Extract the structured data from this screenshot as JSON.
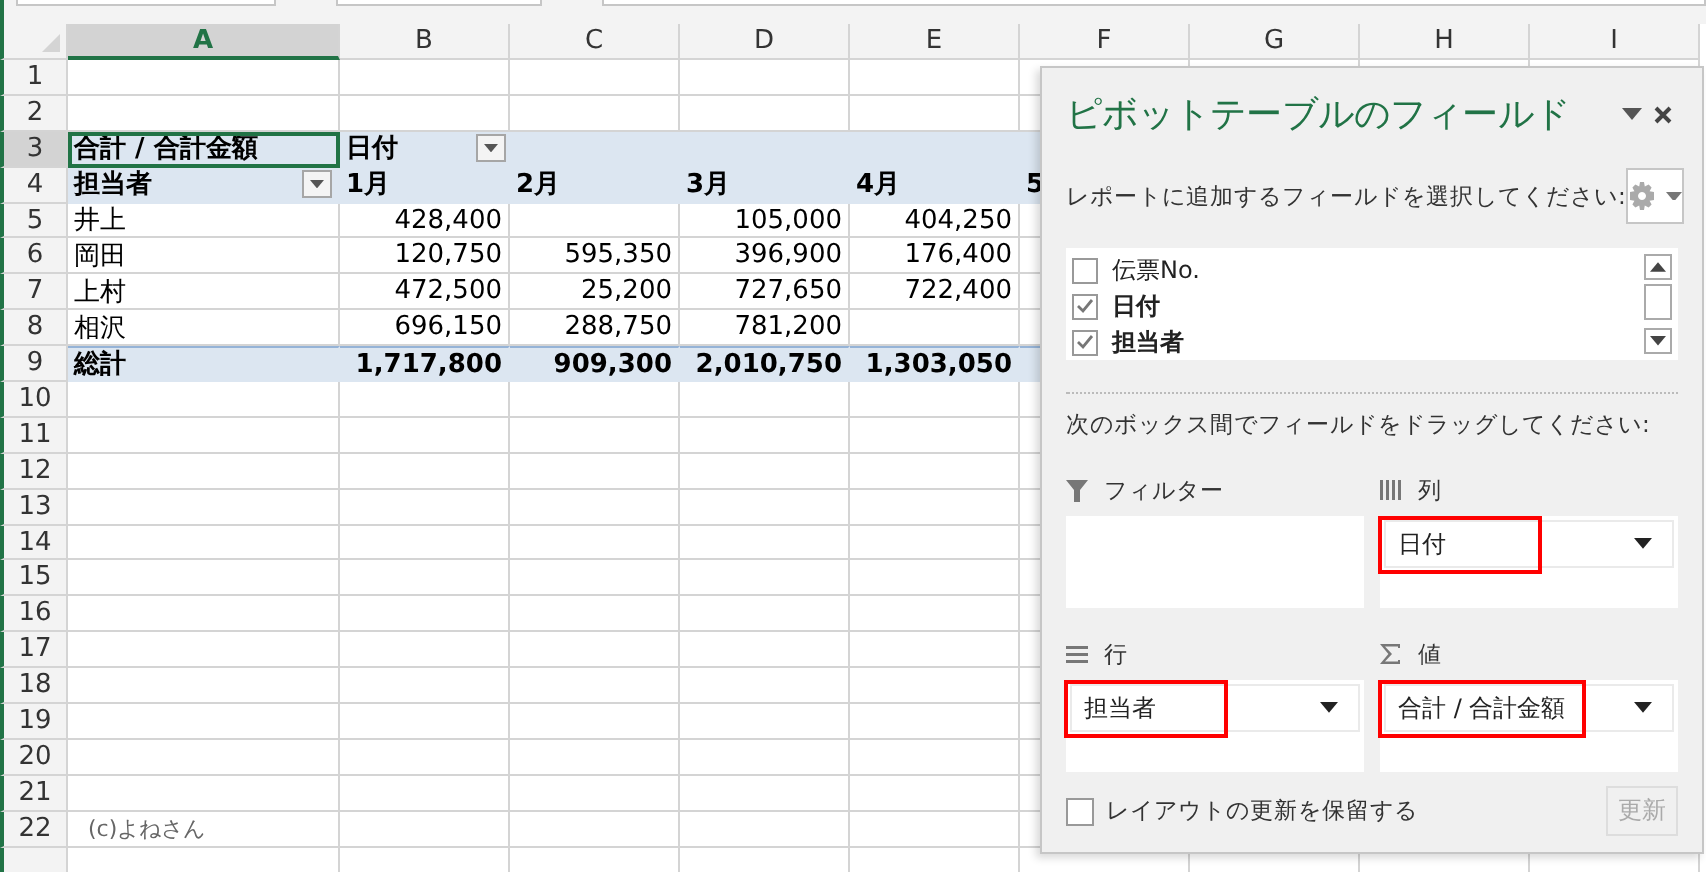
{
  "columns": [
    {
      "label": "A",
      "selected": true
    },
    {
      "label": "B",
      "selected": false
    },
    {
      "label": "C",
      "selected": false
    },
    {
      "label": "D",
      "selected": false
    },
    {
      "label": "E",
      "selected": false
    },
    {
      "label": "F",
      "selected": false
    },
    {
      "label": "G",
      "selected": false
    },
    {
      "label": "H",
      "selected": false
    },
    {
      "label": "I",
      "selected": false
    }
  ],
  "row_numbers": [
    "1",
    "2",
    "3",
    "4",
    "5",
    "6",
    "7",
    "8",
    "9",
    "10",
    "11",
    "12",
    "13",
    "14",
    "15",
    "16",
    "17",
    "18",
    "19",
    "20",
    "21",
    "22"
  ],
  "pivot": {
    "corner": "合計 / 合計金額",
    "corner_active": true,
    "column_field": "日付",
    "row_field": "担当者",
    "months": [
      "1月",
      "2月",
      "3月",
      "4月",
      "5"
    ],
    "rows": [
      {
        "name": "井上",
        "cells": [
          {
            "value": "428,400"
          },
          {
            "blank": true
          },
          {
            "value": "105,000"
          },
          {
            "value": "404,250"
          }
        ]
      },
      {
        "name": "岡田",
        "cells": [
          {
            "value": "120,750"
          },
          {
            "value": "595,350"
          },
          {
            "value": "396,900"
          },
          {
            "value": "176,400"
          }
        ]
      },
      {
        "name": "上村",
        "cells": [
          {
            "value": "472,500"
          },
          {
            "value": "25,200"
          },
          {
            "value": "727,650"
          },
          {
            "value": "722,400"
          }
        ]
      },
      {
        "name": "相沢",
        "cells": [
          {
            "value": "696,150"
          },
          {
            "value": "288,750"
          },
          {
            "value": "781,200"
          },
          {
            "blank": true
          }
        ]
      }
    ],
    "total": {
      "label": "総計",
      "values": [
        "1,717,800",
        "909,300",
        "2,010,750",
        "1,303,050"
      ]
    }
  },
  "credit": "(c)よねさん",
  "panel": {
    "title": "ピボットテーブルのフィールド",
    "instruction": "レポートに追加するフィールドを選択してください:",
    "fields": [
      {
        "label": "伝票No.",
        "checked": false
      },
      {
        "label": "日付",
        "checked": true
      },
      {
        "label": "担当者",
        "checked": true
      }
    ],
    "drag_instruction": "次のボックス間でフィールドをドラッグしてください:",
    "areas": [
      {
        "kind": "filter",
        "label": "フィルター"
      },
      {
        "kind": "columns",
        "label": "列",
        "items": [
          {
            "label": "日付",
            "highlighted": true
          }
        ]
      },
      {
        "kind": "rows",
        "label": "行",
        "items": [
          {
            "label": "担当者",
            "highlighted": true
          }
        ]
      },
      {
        "kind": "values",
        "label": "値",
        "items": [
          {
            "label": "合計 / 合計金額",
            "highlighted": true
          }
        ]
      }
    ],
    "defer": {
      "label": "レイアウトの更新を保留する",
      "checked": false
    },
    "update_button": {
      "label": "更新",
      "disabled": true
    }
  }
}
